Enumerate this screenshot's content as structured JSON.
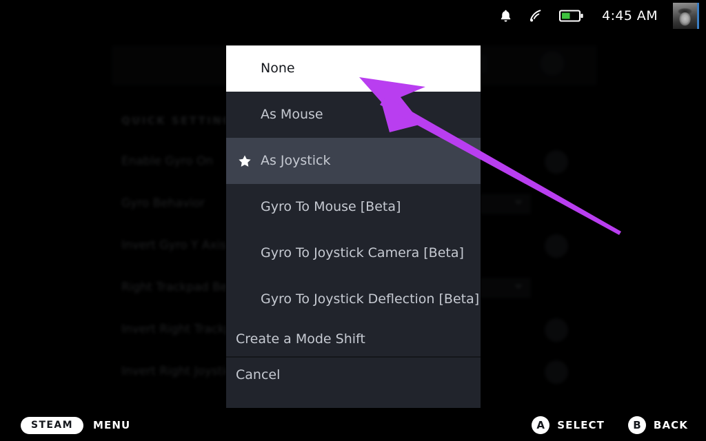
{
  "statusbar": {
    "icons": [
      {
        "name": "notification-bell-icon",
        "label": "Notifications"
      },
      {
        "name": "wifi-icon",
        "label": "Wi-Fi"
      },
      {
        "name": "battery-icon",
        "label": "Battery"
      }
    ],
    "time": "4:45 AM",
    "avatar_name": "user-avatar"
  },
  "background": {
    "section_title": "QUICK SETTINGS",
    "rows": [
      {
        "label": "Enable Gyro On",
        "control": "toggle"
      },
      {
        "label": "Gyro Behavior",
        "control": "dropdown"
      },
      {
        "label": "Invert Gyro Y Axis",
        "control": "toggle"
      },
      {
        "label": "Right Trackpad Behavior",
        "control": "dropdown"
      },
      {
        "label": "Invert Right Trackpad",
        "control": "toggle"
      },
      {
        "label": "Invert Right Joystick",
        "control": "toggle"
      }
    ]
  },
  "menu": {
    "items": [
      {
        "label": "None",
        "state": "selected",
        "starred": false
      },
      {
        "label": "As Mouse",
        "state": "normal",
        "starred": false
      },
      {
        "label": "As Joystick",
        "state": "highlighted",
        "starred": true
      },
      {
        "label": "Gyro To Mouse [Beta]",
        "state": "normal",
        "starred": false
      },
      {
        "label": "Gyro To Joystick Camera [Beta]",
        "state": "normal",
        "starred": false
      },
      {
        "label": "Gyro To Joystick Deflection [Beta]",
        "state": "normal",
        "starred": false
      }
    ],
    "create_mode_shift": "Create a Mode Shift",
    "cancel": "Cancel",
    "star_glyph": "★"
  },
  "annotation": {
    "arrow_color": "#b93ef0",
    "name": "pointer-arrow-annotation"
  },
  "bottombar": {
    "steam_label": "STEAM",
    "menu_label": "MENU",
    "actions": [
      {
        "button": "A",
        "label": "SELECT"
      },
      {
        "button": "B",
        "label": "BACK"
      }
    ]
  },
  "colors": {
    "menu_bg": "#21242c",
    "menu_highlight": "#3d424e",
    "menu_selected_bg": "#ffffff",
    "accent_purple": "#b93ef0",
    "battery_green": "#3fc23f",
    "avatar_border": "#3b7ec4"
  }
}
